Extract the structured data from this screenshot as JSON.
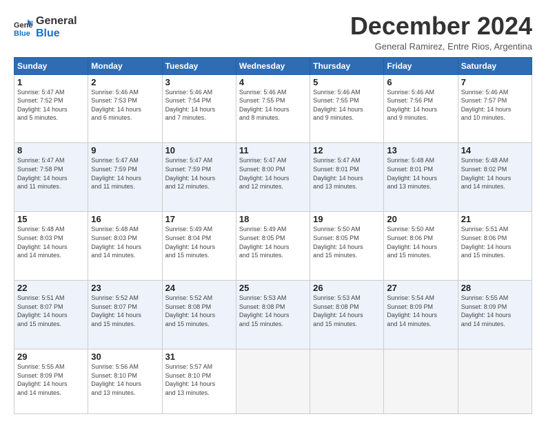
{
  "logo": {
    "line1": "General",
    "line2": "Blue"
  },
  "title": "December 2024",
  "location": "General Ramirez, Entre Rios, Argentina",
  "days_header": [
    "Sunday",
    "Monday",
    "Tuesday",
    "Wednesday",
    "Thursday",
    "Friday",
    "Saturday"
  ],
  "weeks": [
    [
      {
        "day": "1",
        "info": "Sunrise: 5:47 AM\nSunset: 7:52 PM\nDaylight: 14 hours\nand 5 minutes."
      },
      {
        "day": "2",
        "info": "Sunrise: 5:46 AM\nSunset: 7:53 PM\nDaylight: 14 hours\nand 6 minutes."
      },
      {
        "day": "3",
        "info": "Sunrise: 5:46 AM\nSunset: 7:54 PM\nDaylight: 14 hours\nand 7 minutes."
      },
      {
        "day": "4",
        "info": "Sunrise: 5:46 AM\nSunset: 7:55 PM\nDaylight: 14 hours\nand 8 minutes."
      },
      {
        "day": "5",
        "info": "Sunrise: 5:46 AM\nSunset: 7:55 PM\nDaylight: 14 hours\nand 9 minutes."
      },
      {
        "day": "6",
        "info": "Sunrise: 5:46 AM\nSunset: 7:56 PM\nDaylight: 14 hours\nand 9 minutes."
      },
      {
        "day": "7",
        "info": "Sunrise: 5:46 AM\nSunset: 7:57 PM\nDaylight: 14 hours\nand 10 minutes."
      }
    ],
    [
      {
        "day": "8",
        "info": "Sunrise: 5:47 AM\nSunset: 7:58 PM\nDaylight: 14 hours\nand 11 minutes."
      },
      {
        "day": "9",
        "info": "Sunrise: 5:47 AM\nSunset: 7:59 PM\nDaylight: 14 hours\nand 11 minutes."
      },
      {
        "day": "10",
        "info": "Sunrise: 5:47 AM\nSunset: 7:59 PM\nDaylight: 14 hours\nand 12 minutes."
      },
      {
        "day": "11",
        "info": "Sunrise: 5:47 AM\nSunset: 8:00 PM\nDaylight: 14 hours\nand 12 minutes."
      },
      {
        "day": "12",
        "info": "Sunrise: 5:47 AM\nSunset: 8:01 PM\nDaylight: 14 hours\nand 13 minutes."
      },
      {
        "day": "13",
        "info": "Sunrise: 5:48 AM\nSunset: 8:01 PM\nDaylight: 14 hours\nand 13 minutes."
      },
      {
        "day": "14",
        "info": "Sunrise: 5:48 AM\nSunset: 8:02 PM\nDaylight: 14 hours\nand 14 minutes."
      }
    ],
    [
      {
        "day": "15",
        "info": "Sunrise: 5:48 AM\nSunset: 8:03 PM\nDaylight: 14 hours\nand 14 minutes."
      },
      {
        "day": "16",
        "info": "Sunrise: 5:48 AM\nSunset: 8:03 PM\nDaylight: 14 hours\nand 14 minutes."
      },
      {
        "day": "17",
        "info": "Sunrise: 5:49 AM\nSunset: 8:04 PM\nDaylight: 14 hours\nand 15 minutes."
      },
      {
        "day": "18",
        "info": "Sunrise: 5:49 AM\nSunset: 8:05 PM\nDaylight: 14 hours\nand 15 minutes."
      },
      {
        "day": "19",
        "info": "Sunrise: 5:50 AM\nSunset: 8:05 PM\nDaylight: 14 hours\nand 15 minutes."
      },
      {
        "day": "20",
        "info": "Sunrise: 5:50 AM\nSunset: 8:06 PM\nDaylight: 14 hours\nand 15 minutes."
      },
      {
        "day": "21",
        "info": "Sunrise: 5:51 AM\nSunset: 8:06 PM\nDaylight: 14 hours\nand 15 minutes."
      }
    ],
    [
      {
        "day": "22",
        "info": "Sunrise: 5:51 AM\nSunset: 8:07 PM\nDaylight: 14 hours\nand 15 minutes."
      },
      {
        "day": "23",
        "info": "Sunrise: 5:52 AM\nSunset: 8:07 PM\nDaylight: 14 hours\nand 15 minutes."
      },
      {
        "day": "24",
        "info": "Sunrise: 5:52 AM\nSunset: 8:08 PM\nDaylight: 14 hours\nand 15 minutes."
      },
      {
        "day": "25",
        "info": "Sunrise: 5:53 AM\nSunset: 8:08 PM\nDaylight: 14 hours\nand 15 minutes."
      },
      {
        "day": "26",
        "info": "Sunrise: 5:53 AM\nSunset: 8:08 PM\nDaylight: 14 hours\nand 15 minutes."
      },
      {
        "day": "27",
        "info": "Sunrise: 5:54 AM\nSunset: 8:09 PM\nDaylight: 14 hours\nand 14 minutes."
      },
      {
        "day": "28",
        "info": "Sunrise: 5:55 AM\nSunset: 8:09 PM\nDaylight: 14 hours\nand 14 minutes."
      }
    ],
    [
      {
        "day": "29",
        "info": "Sunrise: 5:55 AM\nSunset: 8:09 PM\nDaylight: 14 hours\nand 14 minutes."
      },
      {
        "day": "30",
        "info": "Sunrise: 5:56 AM\nSunset: 8:10 PM\nDaylight: 14 hours\nand 13 minutes."
      },
      {
        "day": "31",
        "info": "Sunrise: 5:57 AM\nSunset: 8:10 PM\nDaylight: 14 hours\nand 13 minutes."
      },
      {
        "day": "",
        "info": ""
      },
      {
        "day": "",
        "info": ""
      },
      {
        "day": "",
        "info": ""
      },
      {
        "day": "",
        "info": ""
      }
    ]
  ]
}
